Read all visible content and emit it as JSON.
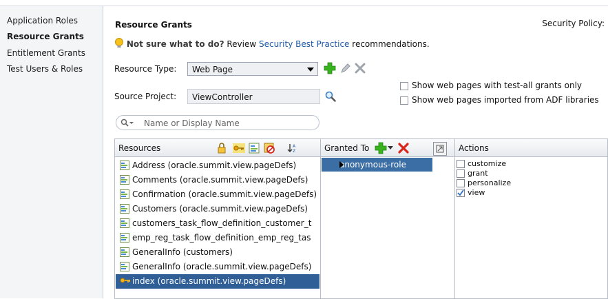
{
  "nav": {
    "items": [
      {
        "label": "Application Roles"
      },
      {
        "label": "Resource Grants"
      },
      {
        "label": "Entitlement Grants"
      },
      {
        "label": "Test Users & Roles"
      }
    ]
  },
  "header": {
    "title": "Resource Grants",
    "policy": "Security Policy:"
  },
  "hint": {
    "bold": "Not sure what to do?",
    "review": "Review",
    "link": "Security Best Practice",
    "rest": "recommendations."
  },
  "form": {
    "resource_type_label": "Resource Type:",
    "resource_type_value": "Web Page",
    "source_project_label": "Source Project:",
    "source_project_value": "ViewController",
    "show_test_all": "Show web pages with test-all grants only",
    "show_imported": "Show web pages imported from ADF libraries",
    "search_placeholder": "Name or Display Name"
  },
  "grid": {
    "col_resources": "Resources",
    "col_granted": "Granted To",
    "col_actions": "Actions",
    "resources": [
      {
        "label": "Address (oracle.summit.view.pageDefs)",
        "icon": "page-def-icon"
      },
      {
        "label": "Comments (oracle.summit.view.pageDefs)",
        "icon": "page-def-icon"
      },
      {
        "label": "Confirmation (oracle.summit.view.pageDefs)",
        "icon": "page-def-icon"
      },
      {
        "label": "Customers (oracle.summit.view.pageDefs)",
        "icon": "page-def-icon"
      },
      {
        "label": "customers_task_flow_definition_customer_t",
        "icon": "page-def-icon"
      },
      {
        "label": "emp_reg_task_flow_definition_emp_reg_tas",
        "icon": "page-def-icon"
      },
      {
        "label": "GeneralInfo (customers)",
        "icon": "page-def-icon"
      },
      {
        "label": "GeneralInfo (oracle.summit.view.pageDefs)",
        "icon": "page-def-icon"
      },
      {
        "label": "index (oracle.summit.view.pageDefs)",
        "icon": "key-icon",
        "selected": true
      }
    ],
    "granted_to": [
      {
        "label": "anonymous-role"
      }
    ],
    "actions": [
      {
        "label": "customize",
        "checked": false
      },
      {
        "label": "grant",
        "checked": false
      },
      {
        "label": "personalize",
        "checked": false
      },
      {
        "label": "view",
        "checked": true
      }
    ]
  },
  "colors": {
    "selected_row": "#2f5f96",
    "role_highlight": "#3a6ea5",
    "link": "#1e5aa6",
    "add_green": "#39b21f",
    "delete_red": "#d8261c"
  }
}
